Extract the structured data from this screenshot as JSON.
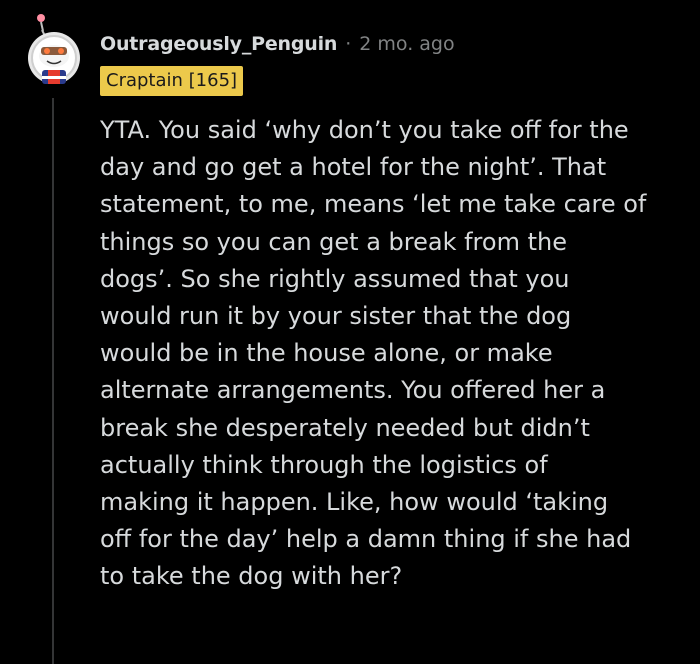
{
  "comment": {
    "username": "Outrageously_Penguin",
    "separator": "·",
    "time_ago": "2 mo. ago",
    "flair": "Craptain [165]",
    "avatar_icon": "snoo-avatar-icon",
    "body_lines": [
      "YTA. You said ‘why don’t you take off for the",
      "day and go get a hotel for the night’. That",
      "statement, to me, means ‘let me take care of",
      "things so you can get a break from the",
      "dogs’. So she rightly assumed that you",
      "would run it by your sister that the dog",
      "would be in the house alone, or make",
      "alternate arrangements. You offered her a",
      "break she desperately needed but didn’t",
      "actually think through the logistics of",
      "making it happen. Like, how would ‘taking",
      "off for the day’ help a damn thing if she had",
      "to take the dog with her?"
    ]
  },
  "colors": {
    "background": "#000000",
    "text": "#d7dadc",
    "meta": "#818384",
    "flair_bg": "#ecc94b",
    "thread_line": "#343536"
  }
}
